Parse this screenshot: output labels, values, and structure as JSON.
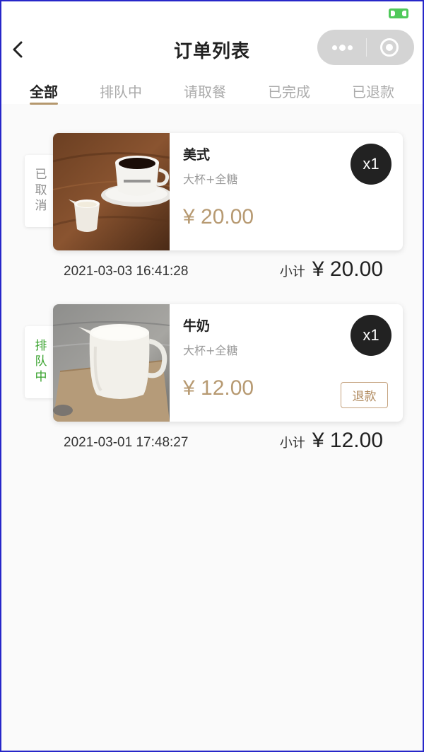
{
  "header": {
    "title": "订单列表",
    "back_icon": "chevron-left-icon",
    "more_icon": "more-dots-icon",
    "close_icon": "target-circle-icon"
  },
  "tabs": [
    {
      "label": "全部",
      "active": true
    },
    {
      "label": "排队中",
      "active": false
    },
    {
      "label": "请取餐",
      "active": false
    },
    {
      "label": "已完成",
      "active": false
    },
    {
      "label": "已退款",
      "active": false
    }
  ],
  "orders": [
    {
      "status": "已取消",
      "status_color": "#8c8c8c",
      "item_name": "美式",
      "item_spec": "大杯+全糖",
      "price": "¥ 20.00",
      "quantity": "x1",
      "time": "2021-03-03 16:41:28",
      "subtotal_label": "小计",
      "subtotal_amount": "¥ 20.00",
      "image": "coffee-cup-photo"
    },
    {
      "status": "排队中",
      "status_color": "#3aa32f",
      "item_name": "牛奶",
      "item_spec": "大杯+全糖",
      "price": "¥ 12.00",
      "quantity": "x1",
      "refund_label": "退款",
      "time": "2021-03-01 17:48:27",
      "subtotal_label": "小计",
      "subtotal_amount": "¥ 12.00",
      "image": "milk-jug-photo"
    }
  ],
  "colors": {
    "accent": "#b79a72",
    "tab_underline": "#b5986e",
    "frame_border": "#2727c9"
  }
}
